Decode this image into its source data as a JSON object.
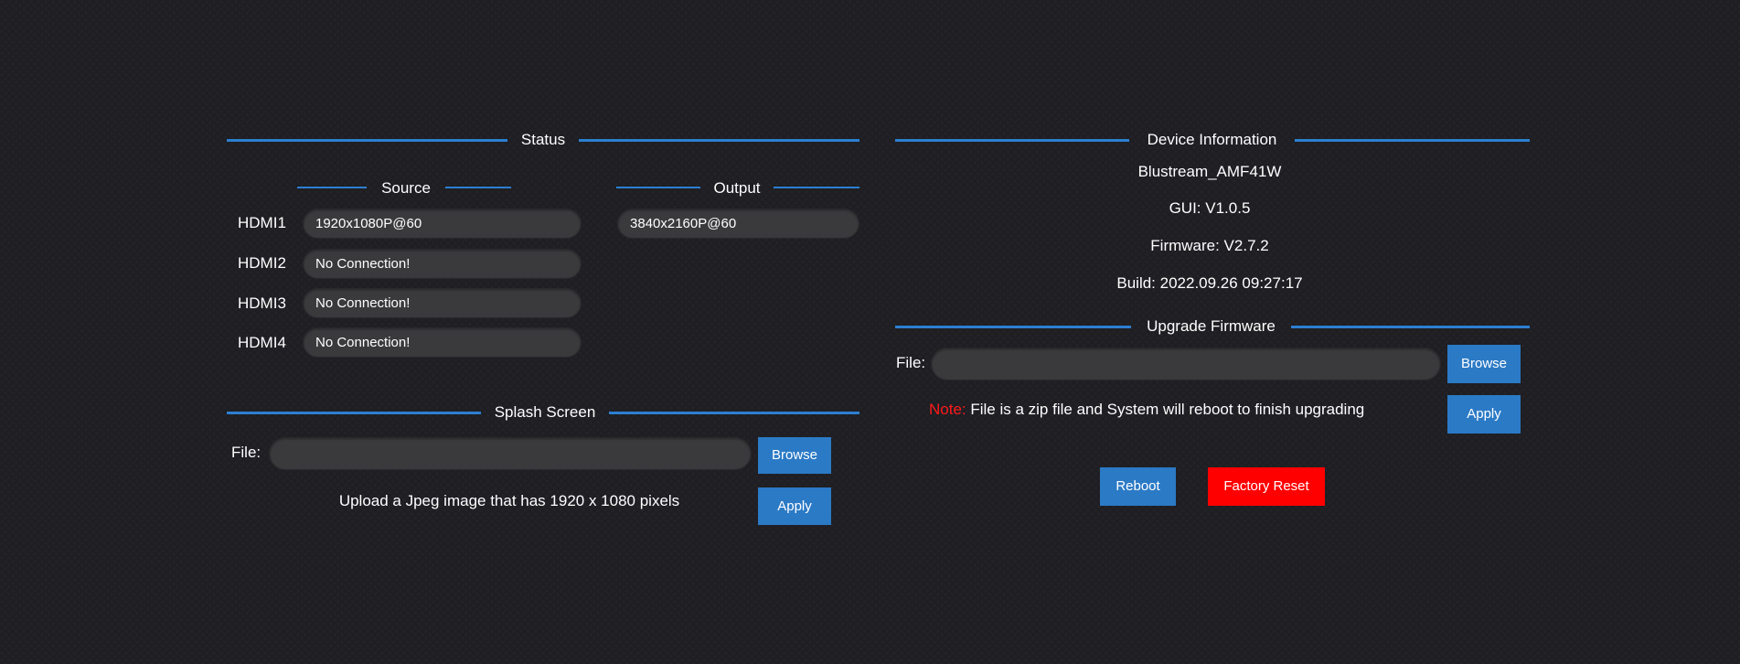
{
  "status": {
    "title": "Status",
    "source_title": "Source",
    "output_title": "Output",
    "sources": [
      {
        "label": "HDMI1",
        "value": "1920x1080P@60"
      },
      {
        "label": "HDMI2",
        "value": "No Connection!"
      },
      {
        "label": "HDMI3",
        "value": "No Connection!"
      },
      {
        "label": "HDMI4",
        "value": "No Connection!"
      }
    ],
    "output_value": "3840x2160P@60"
  },
  "splash": {
    "title": "Splash Screen",
    "file_label": "File:",
    "browse_label": "Browse",
    "apply_label": "Apply",
    "hint": "Upload a Jpeg image that has 1920 x 1080 pixels"
  },
  "device": {
    "title": "Device Information",
    "name": "Blustream_AMF41W",
    "gui": "GUI: V1.0.5",
    "firmware": "Firmware: V2.7.2",
    "build": "Build: 2022.09.26 09:27:17"
  },
  "upgrade": {
    "title": "Upgrade Firmware",
    "file_label": "File:",
    "browse_label": "Browse",
    "apply_label": "Apply",
    "note_label": "Note:",
    "note_text": " File is a zip file and System will reboot to finish upgrading"
  },
  "actions": {
    "reboot_label": "Reboot",
    "factory_reset_label": "Factory Reset"
  },
  "colors": {
    "background": "#1e1e23",
    "accent_line": "#2c7fd1",
    "button_blue": "#2b7ac6",
    "button_red": "#ff0000",
    "note_red": "#ff1a1a",
    "field_bg": "#3a3a3d"
  }
}
